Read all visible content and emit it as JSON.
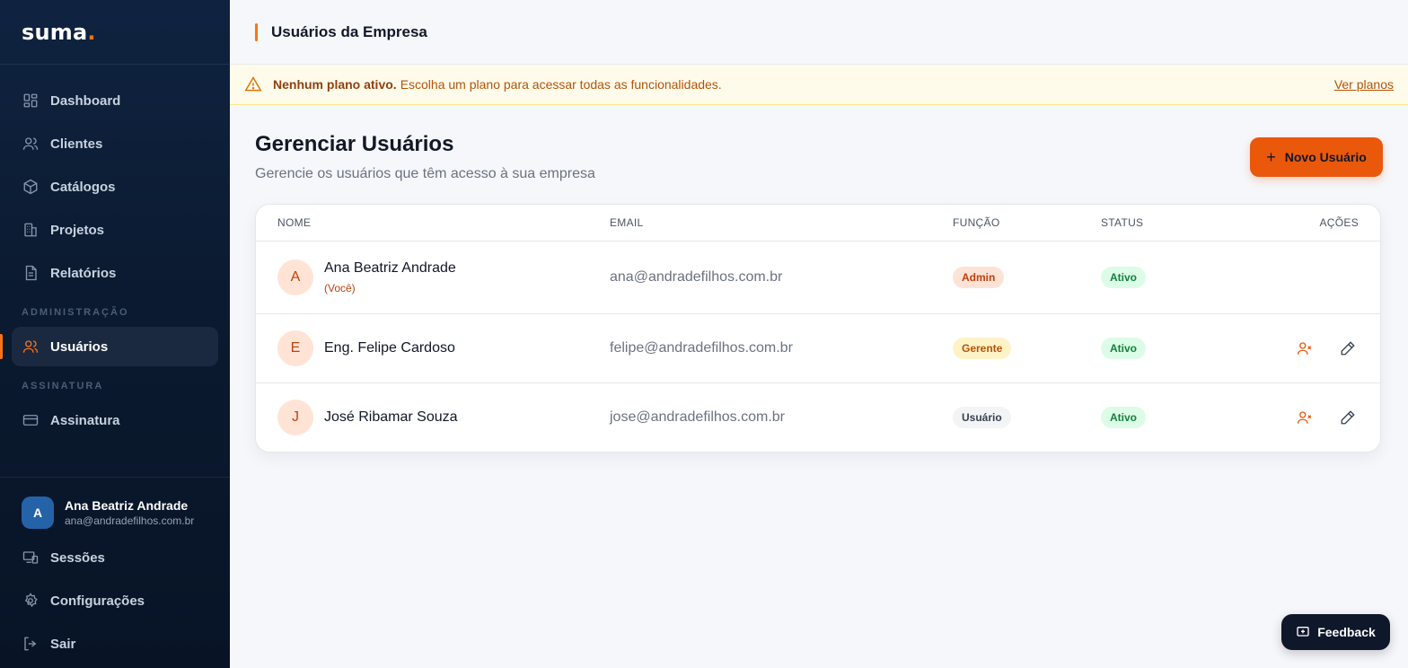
{
  "brand": {
    "name": "suma",
    "dot": "."
  },
  "sidebar": {
    "nav": [
      {
        "label": "Dashboard",
        "icon": "dashboard-icon"
      },
      {
        "label": "Clientes",
        "icon": "users-icon"
      },
      {
        "label": "Catálogos",
        "icon": "box-icon"
      },
      {
        "label": "Projetos",
        "icon": "building-icon"
      },
      {
        "label": "Relatórios",
        "icon": "report-icon"
      }
    ],
    "admin_section": "ADMINISTRAÇÃO",
    "admin_items": [
      {
        "label": "Usuários",
        "icon": "users-icon",
        "active": true
      }
    ],
    "billing_section": "ASSINATURA",
    "billing_items": [
      {
        "label": "Assinatura",
        "icon": "credit-card-icon"
      }
    ],
    "user": {
      "initial": "A",
      "name": "Ana Beatriz Andrade",
      "email": "ana@andradefilhos.com.br"
    },
    "bottom_items": [
      {
        "label": "Sessões",
        "icon": "devices-icon"
      },
      {
        "label": "Configurações",
        "icon": "gear-icon"
      },
      {
        "label": "Sair",
        "icon": "logout-icon"
      }
    ]
  },
  "topbar": {
    "title": "Usuários da Empresa"
  },
  "banner": {
    "strong": "Nenhum plano ativo.",
    "text": "Escolha um plano para acessar todas as funcionalidades.",
    "link": "Ver planos"
  },
  "page": {
    "title": "Gerenciar Usuários",
    "subtitle": "Gerencie os usuários que têm acesso à sua empresa",
    "new_button": "Novo Usuário"
  },
  "table": {
    "headers": {
      "nome": "NOME",
      "email": "EMAIL",
      "funcao": "FUNÇÃO",
      "status": "STATUS",
      "acoes": "AÇÕES"
    },
    "rows": [
      {
        "initial": "A",
        "name": "Ana Beatriz Andrade",
        "you": "(Você)",
        "email": "ana@andradefilhos.com.br",
        "role": "Admin",
        "status": "Ativo"
      },
      {
        "initial": "E",
        "name": "Eng. Felipe Cardoso",
        "email": "felipe@andradefilhos.com.br",
        "role": "Gerente",
        "status": "Ativo"
      },
      {
        "initial": "J",
        "name": "José Ribamar Souza",
        "email": "jose@andradefilhos.com.br",
        "role": "Usuário",
        "status": "Ativo"
      }
    ]
  },
  "feedback": {
    "label": "Feedback"
  },
  "colors": {
    "accent": "#ea580c",
    "sidebar_bg": "#0b1a30",
    "banner_bg": "#fffbeb",
    "active_badge": "#dcfce7"
  }
}
